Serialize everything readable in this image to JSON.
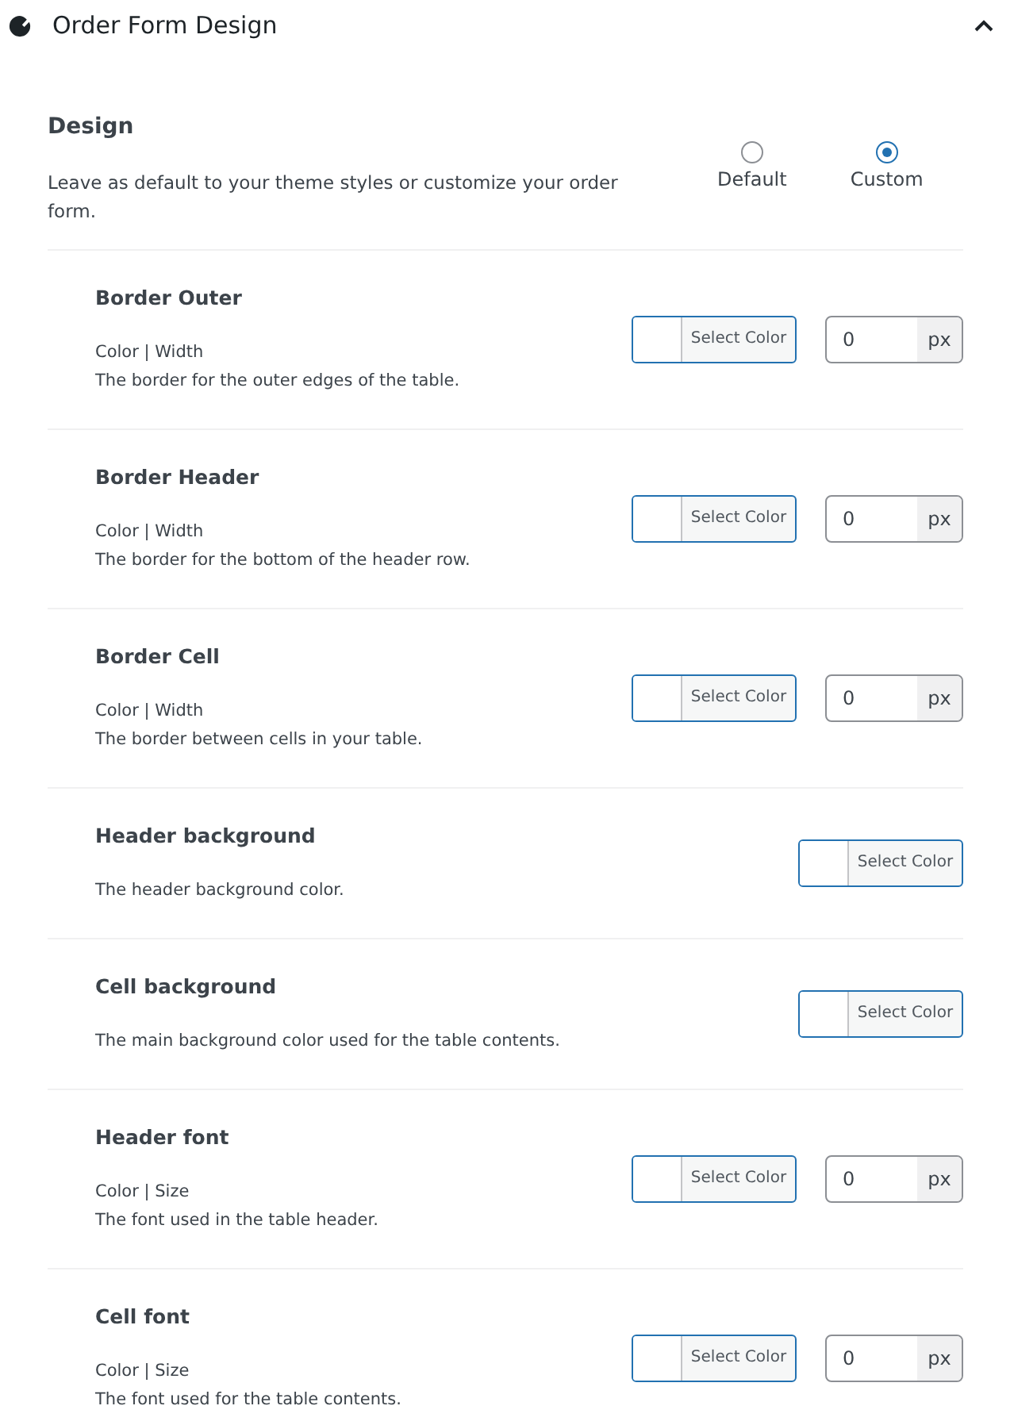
{
  "panel": {
    "title": "Order Form Design",
    "expanded": true
  },
  "design": {
    "title": "Design",
    "description": "Leave as default to your theme styles or customize your order form.",
    "options": [
      {
        "label": "Default",
        "selected": false
      },
      {
        "label": "Custom",
        "selected": true
      }
    ]
  },
  "rows": [
    {
      "kind": "color_width",
      "title": "Border Outer",
      "subtitle": "Color | Width",
      "description": "The border for the outer edges of the table.",
      "button": "Select Color",
      "value": "0",
      "unit": "px"
    },
    {
      "kind": "color_width",
      "title": "Border Header",
      "subtitle": "Color | Width",
      "description": "The border for the bottom of the header row.",
      "button": "Select Color",
      "value": "0",
      "unit": "px"
    },
    {
      "kind": "color_width",
      "title": "Border Cell",
      "subtitle": "Color | Width",
      "description": "The border between cells in your table.",
      "button": "Select Color",
      "value": "0",
      "unit": "px"
    },
    {
      "kind": "color",
      "title": "Header background",
      "description": "The header background color.",
      "button": "Select Color"
    },
    {
      "kind": "color",
      "title": "Cell background",
      "description": "The main background color used for the table contents.",
      "button": "Select Color"
    },
    {
      "kind": "color_width",
      "title": "Header font",
      "subtitle": "Color | Size",
      "description": "The font used in the table header.",
      "button": "Select Color",
      "value": "0",
      "unit": "px"
    },
    {
      "kind": "color_width",
      "title": "Cell font",
      "subtitle": "Color | Size",
      "description": "The font used for the table contents.",
      "button": "Select Color",
      "value": "0",
      "unit": "px"
    }
  ]
}
